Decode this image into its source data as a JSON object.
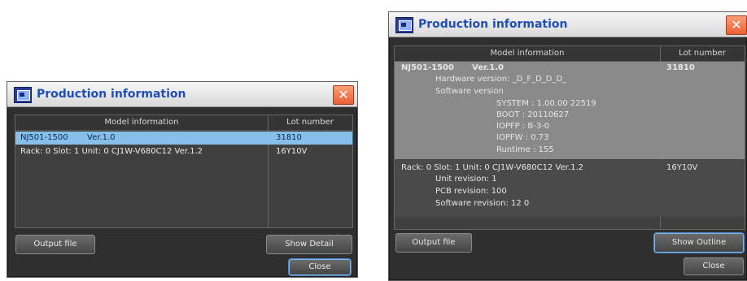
{
  "dialog_left": {
    "title": "Production information",
    "close_glyph": "✕",
    "columns": [
      "Model information",
      "Lot number"
    ],
    "rows": [
      {
        "model": "NJ501-1500",
        "version": "Ver.1.0",
        "lot": "31810",
        "selected": true
      },
      {
        "model": "Rack: 0 Slot: 1 Unit: 0 CJ1W-V680C12 Ver.1.2",
        "version": "",
        "lot": "16Y10V",
        "selected": false
      }
    ],
    "output_button": "Output file",
    "toggle_button": "Show Detail",
    "close_button": "Close"
  },
  "dialog_right": {
    "title": "Production information",
    "close_glyph": "✕",
    "columns": [
      "Model information",
      "Lot number"
    ],
    "row1": {
      "model": "NJ501-1500",
      "version": "Ver.1.0",
      "lot": "31810",
      "hardware": "Hardware version: _D_F_D_D_D_",
      "software_label": "Software version",
      "software_items": [
        "SYSTEM : 1.00.00 22519",
        "BOOT : 20110627",
        "IOPFP : B-3-0",
        "IOPFW : 0.73",
        "Runtime : 155"
      ]
    },
    "row2": {
      "model": "Rack: 0 Slot: 1 Unit: 0 CJ1W-V680C12 Ver.1.2",
      "lot": "16Y10V",
      "details": [
        "Unit revision: 1",
        "PCB revision: 100",
        "Software revision: 12 0"
      ]
    },
    "output_button": "Output file",
    "toggle_button": "Show Outline",
    "close_button": "Close"
  },
  "colors": {
    "title_text": "#1f4eb8",
    "selection": "#86bfea",
    "close_button": "#e85f35",
    "focus_border": "#7fb5e8"
  },
  "icons": [
    "app-icon",
    "close-icon"
  ]
}
